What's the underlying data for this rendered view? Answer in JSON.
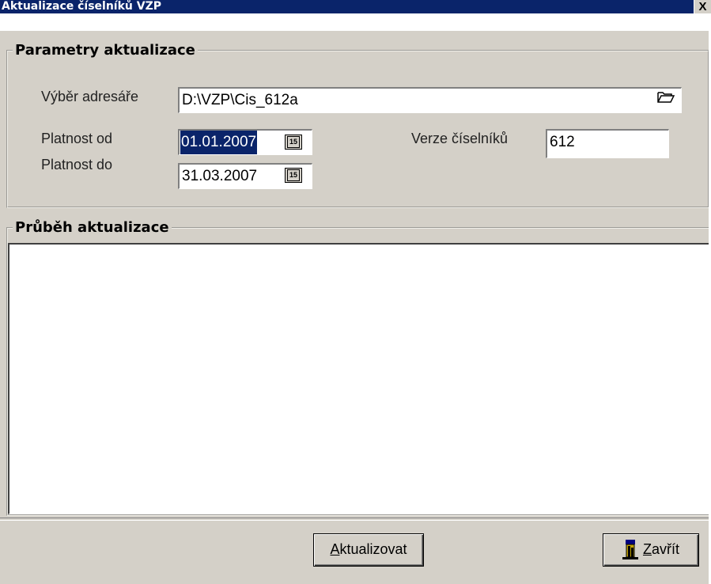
{
  "window": {
    "title": "Aktualizace číselníků VZP",
    "close_glyph": "X"
  },
  "params": {
    "group_label": "Parametry aktualizace",
    "dir_label": "Výběr adresáře",
    "dir_value": "D:\\VZP\\Cis_612a",
    "from_label": "Platnost od",
    "from_value": "01.01.2007",
    "to_label": "Platnost do",
    "to_value": "31.03.2007",
    "calendar_glyph": "15",
    "version_label": "Verze číselníků",
    "version_value": "612"
  },
  "progress": {
    "group_label": "Průběh aktualizace"
  },
  "buttons": {
    "update_label_hot": "A",
    "update_label_rest": "ktualizovat",
    "close_label_hot": "Z",
    "close_label_rest": "avřít"
  },
  "icons": {
    "folder": "folder-open-icon",
    "calendar": "calendar-icon",
    "exit": "exit-door-icon"
  }
}
